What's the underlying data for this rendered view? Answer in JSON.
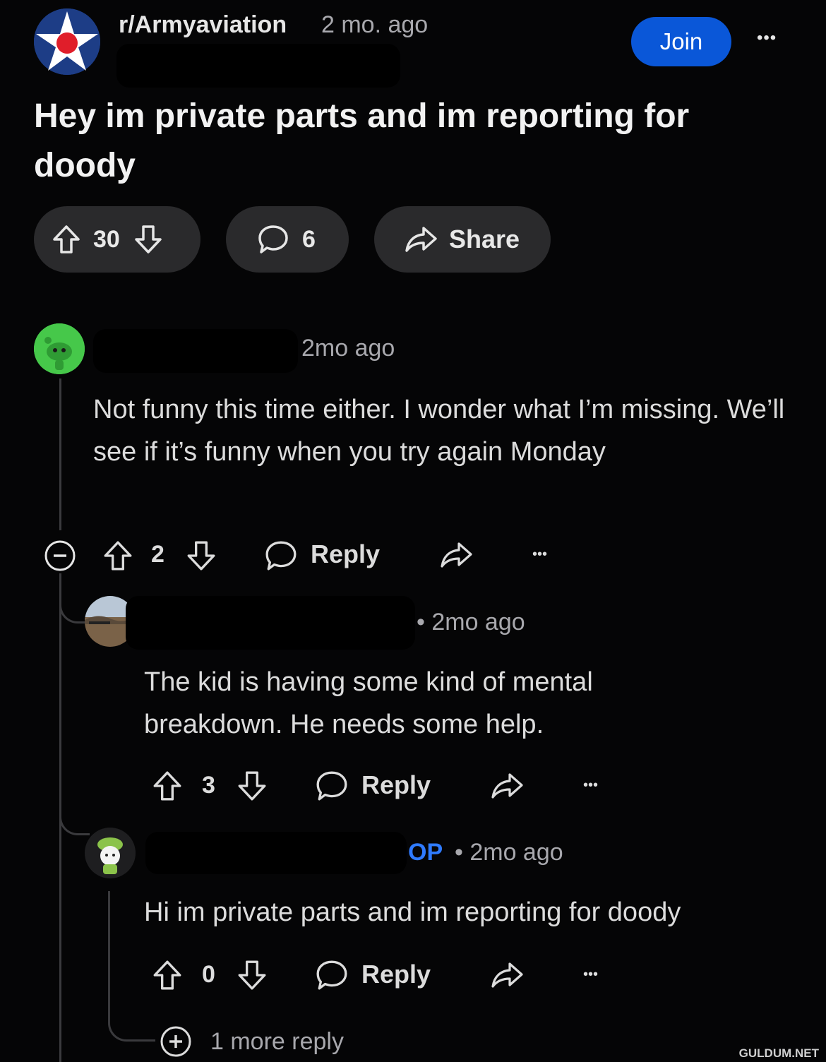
{
  "post": {
    "subreddit": "r/Armyaviation",
    "time": "2 mo. ago",
    "join_label": "Join",
    "more_label": "•••",
    "title": "Hey im private parts and im reporting for doody",
    "upvotes": "30",
    "comments": "6",
    "share_label": "Share"
  },
  "comments": [
    {
      "time": "2mo ago",
      "body": "Not funny this time either. I wonder what I’m missing. We’ll see if it’s funny when you try again Monday",
      "votes": "2",
      "reply_label": "Reply",
      "more_label": "•••"
    },
    {
      "time": "• 2mo ago",
      "body": "The kid is having some kind of mental breakdown. He needs some help.",
      "votes": "3",
      "reply_label": "Reply",
      "more_label": "•••"
    },
    {
      "op_badge": "OP",
      "time": "• 2mo ago",
      "body": "Hi im private parts and im reporting for doody",
      "votes": "0",
      "reply_label": "Reply",
      "more_label": "•••"
    }
  ],
  "more_replies": "1 more reply",
  "watermark": "GULDUM.NET",
  "colors": {
    "background": "#050506",
    "join_button": "#0a57d8",
    "op_badge": "#2f7bff",
    "pill": "#2a2a2c",
    "avatar_green": "#46c84a"
  }
}
